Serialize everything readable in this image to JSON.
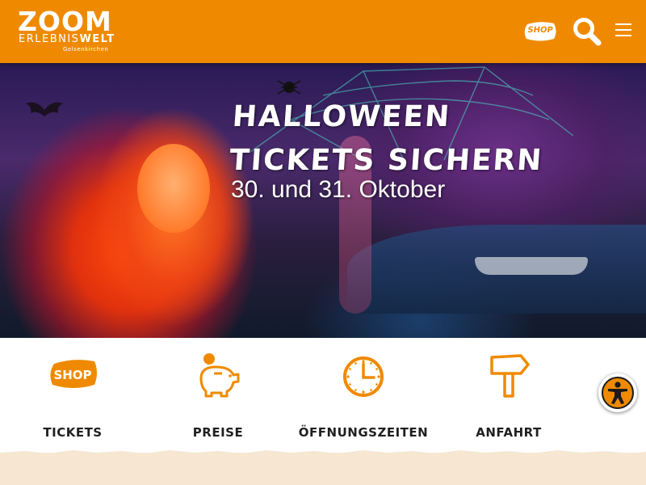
{
  "header": {
    "logo": {
      "main": "ZOOM",
      "sub_light": "ERLEBNIS",
      "sub_bold": "WELT",
      "city": "Gelsenkirchen"
    },
    "shop_label": "SHOP",
    "search_icon": "search-icon",
    "menu_icon": "hamburger-menu-icon"
  },
  "hero": {
    "title": "HALLOWEEN TICKETS SICHERN",
    "subtitle": "30. und 31. Oktober"
  },
  "quick_links": [
    {
      "label": "TICKETS",
      "icon": "shop-tag-icon",
      "badge": "SHOP"
    },
    {
      "label": "PREISE",
      "icon": "piggy-bank-icon"
    },
    {
      "label": "ÖFFNUNGSZEITEN",
      "icon": "clock-icon"
    },
    {
      "label": "ANFAHRT",
      "icon": "signpost-icon"
    }
  ],
  "accessibility": {
    "icon": "accessibility-person-icon"
  },
  "colors": {
    "brand_orange": "#ef8a00",
    "text_dark": "#1f1f1f",
    "sand": "#f6e6d2"
  }
}
